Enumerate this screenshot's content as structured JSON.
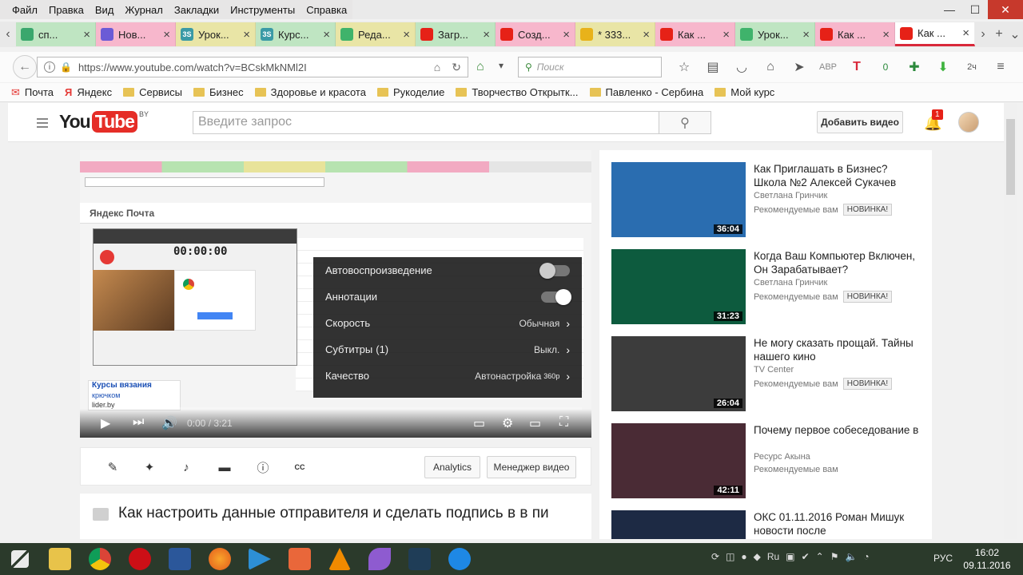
{
  "menu": [
    "Файл",
    "Правка",
    "Вид",
    "Журнал",
    "Закладки",
    "Инструменты",
    "Справка"
  ],
  "window_controls": {
    "minimize": "—",
    "maximize": "☐",
    "close": "✕"
  },
  "tabs": [
    {
      "label": "сп...",
      "color": "#bfe5c2",
      "fav_color": "#3aa76d"
    },
    {
      "label": "Нов...",
      "color": "#f7b7cc",
      "fav_color": "#6b5bd6"
    },
    {
      "label": "Урок...",
      "color": "#e9e5a6",
      "fav_color": "#3a9aa6",
      "fav_text": "3S"
    },
    {
      "label": "Курс...",
      "color": "#bfe5c2",
      "fav_color": "#3a9aa6",
      "fav_text": "3S"
    },
    {
      "label": "Реда...",
      "color": "#e9e5a6",
      "fav_color": "#3fb36b"
    },
    {
      "label": "Загр...",
      "color": "#bfe5c2",
      "fav_color": "#e62117"
    },
    {
      "label": "Созд...",
      "color": "#f7b7cc",
      "fav_color": "#e62117"
    },
    {
      "label": "* 333...",
      "color": "#e9e5a6",
      "fav_color": "#e8b21a"
    },
    {
      "label": "Как ...",
      "color": "#f7b7cc",
      "fav_color": "#e62117"
    },
    {
      "label": "Урок...",
      "color": "#bfe5c2",
      "fav_color": "#3fb36b"
    },
    {
      "label": "Как ...",
      "color": "#f7b7cc",
      "fav_color": "#e62117"
    },
    {
      "label": "Как ...",
      "color": "#ffffff",
      "fav_color": "#e62117",
      "active": true
    }
  ],
  "nav": {
    "url": "https://www.youtube.com/watch?v=BCskMkNMl2I",
    "search_placeholder": "Поиск"
  },
  "bookmarks": [
    "Почта",
    "Яндекс",
    "Сервисы",
    "Бизнес",
    "Здоровье и красота",
    "Рукоделие",
    "Творчество Открытк...",
    "Павленко - Сербина",
    "Мой курс"
  ],
  "youtube": {
    "logo_you": "You",
    "logo_tube": "Tube",
    "region": "BY",
    "search_placeholder": "Введите запрос",
    "upload_label": "Добавить видео",
    "notifications": "1"
  },
  "player": {
    "inner_brand": "Яндекс Почта",
    "icam_time": "00:00:00",
    "knit_ad_title": "Курсы вязания",
    "knit_ad_sub": "крючком",
    "knit_ad_domain": "lider.by",
    "time": "0:00 / 3:21",
    "settings": [
      {
        "label": "Автовоспроизведение",
        "type": "toggle",
        "on": false
      },
      {
        "label": "Аннотации",
        "type": "toggle",
        "on": true
      },
      {
        "label": "Скорость",
        "type": "menu",
        "value": "Обычная"
      },
      {
        "label": "Субтитры",
        "count": "(1)",
        "type": "menu",
        "value": "Выкл."
      },
      {
        "label": "Качество",
        "type": "menu",
        "value": "Автонастройка",
        "hd": "360p"
      }
    ]
  },
  "actions": {
    "analytics": "Analytics",
    "manager": "Менеджер видео"
  },
  "video_title": "Как настроить данные отправителя и сделать подпись в в пи",
  "recommended": [
    {
      "title": "Как Приглашать в Бизнес? Школа №2 Алексей Сукачев",
      "channel": "Светлана Гринчик",
      "meta": "Рекомендуемые вам",
      "badge": "НОВИНКА!",
      "duration": "36:04",
      "thumb": "#2a6db0"
    },
    {
      "title": "Когда Ваш Компьютер Включен, Он Зарабатывает?",
      "channel": "Светлана Гринчик",
      "meta": "Рекомендуемые вам",
      "badge": "НОВИНКА!",
      "duration": "31:23",
      "thumb": "#0d5b3e"
    },
    {
      "title": "Не могу сказать прощай. Тайны нашего кино",
      "channel": "TV Center",
      "meta": "Рекомендуемые вам",
      "badge": "НОВИНКА!",
      "duration": "26:04",
      "thumb": "#3c3c3c"
    },
    {
      "title": "Почему первое собеседование в",
      "channel": "Ресурс Акына",
      "meta": "Рекомендуемые вам",
      "badge": "",
      "duration": "42:11",
      "thumb": "#4a2b35"
    },
    {
      "title": "ОКС 01.11.2016 Роман Мишук новости после",
      "channel": "",
      "meta": "",
      "badge": "",
      "duration": "",
      "thumb": "#1d2a44"
    }
  ],
  "taskbar": {
    "lang": "РУС",
    "time": "16:02",
    "date": "09.11.2016"
  }
}
